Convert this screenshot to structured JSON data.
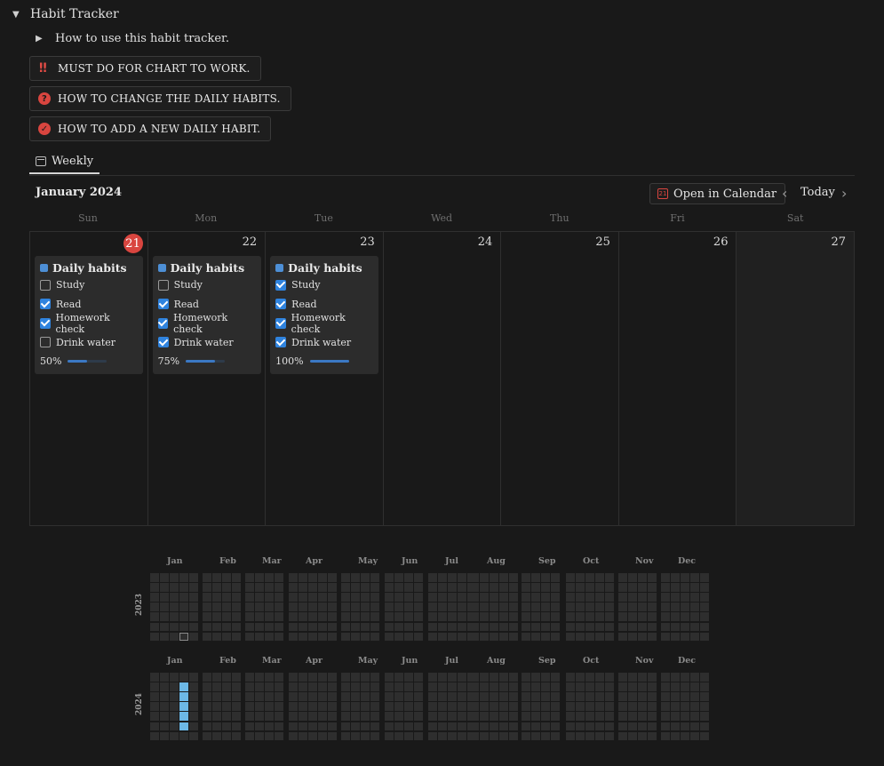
{
  "header": {
    "title": "Habit Tracker"
  },
  "subtoggle": {
    "label": "How to use this habit tracker."
  },
  "callouts": [
    {
      "label": "MUST DO FOR CHART TO WORK.",
      "icon": "double-exclamation-icon"
    },
    {
      "label": "HOW TO CHANGE THE DAILY HABITS.",
      "icon": "question-icon"
    },
    {
      "label": "HOW TO ADD A NEW DAILY HABIT.",
      "icon": "checkmark-icon"
    }
  ],
  "tabs": [
    {
      "label": "Weekly",
      "icon": "calendar-icon"
    }
  ],
  "calendar": {
    "month_label": "January 2024",
    "open_button": "Open in Calendar",
    "open_icon_day": "21",
    "today_label": "Today",
    "weekdays": [
      "Sun",
      "Mon",
      "Tue",
      "Wed",
      "Thu",
      "Fri",
      "Sat"
    ],
    "days": [
      {
        "num": "21",
        "today": true,
        "card": {
          "title": "Daily habits",
          "progress": "50%",
          "progress_value": 0.5,
          "habits": [
            {
              "label": "Study",
              "checked": false
            },
            {
              "label": "Read",
              "checked": true
            },
            {
              "label": "Homework check",
              "checked": true
            },
            {
              "label": "Drink water",
              "checked": false
            }
          ]
        }
      },
      {
        "num": "22",
        "card": {
          "title": "Daily habits",
          "progress": "75%",
          "progress_value": 0.75,
          "habits": [
            {
              "label": "Study",
              "checked": false
            },
            {
              "label": "Read",
              "checked": true
            },
            {
              "label": "Homework check",
              "checked": true
            },
            {
              "label": "Drink water",
              "checked": true
            }
          ]
        }
      },
      {
        "num": "23",
        "card": {
          "title": "Daily habits",
          "progress": "100%",
          "progress_value": 1.0,
          "habits": [
            {
              "label": "Study",
              "checked": true
            },
            {
              "label": "Read",
              "checked": true
            },
            {
              "label": "Homework check",
              "checked": true
            },
            {
              "label": "Drink water",
              "checked": true
            }
          ]
        }
      },
      {
        "num": "24"
      },
      {
        "num": "25"
      },
      {
        "num": "26"
      },
      {
        "num": "27"
      }
    ]
  },
  "heatmap": {
    "colors": {
      "empty": "#2e2e2e",
      "filled": "#6cb8e6"
    },
    "years": [
      {
        "year": "2023",
        "months": [
          "Jan",
          "Feb",
          "Mar",
          "Apr",
          "May",
          "Jun",
          "Jul",
          "Aug",
          "Sep",
          "Oct",
          "Nov",
          "Dec"
        ],
        "marked_week": 3,
        "marked_day": 6,
        "filled": []
      },
      {
        "year": "2024",
        "months": [
          "Jan",
          "Feb",
          "Mar",
          "Apr",
          "May",
          "Jun",
          "Jul",
          "Aug",
          "Sep",
          "Oct",
          "Nov",
          "Dec"
        ],
        "filled": [
          [
            3,
            1
          ],
          [
            3,
            2
          ],
          [
            3,
            3
          ],
          [
            3,
            4
          ],
          [
            3,
            5
          ]
        ]
      }
    ]
  }
}
